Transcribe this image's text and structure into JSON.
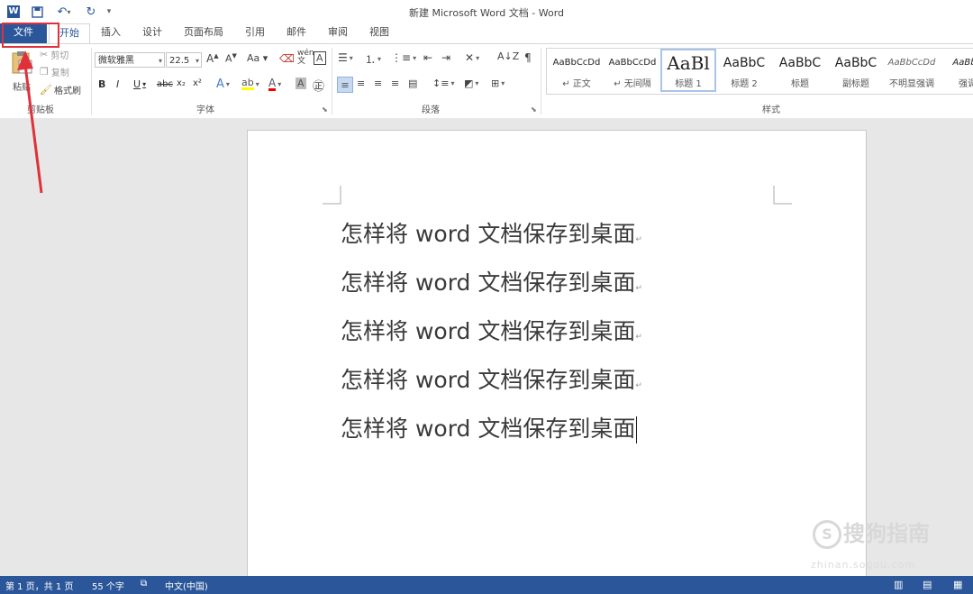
{
  "window": {
    "title": "新建 Microsoft Word 文档 - Word"
  },
  "quick_access": [
    "word-app-icon",
    "save-icon",
    "undo-icon",
    "redo-icon",
    "customize-qat-icon"
  ],
  "tabs": [
    {
      "label": "文件"
    },
    {
      "label": "开始"
    },
    {
      "label": "插入"
    },
    {
      "label": "设计"
    },
    {
      "label": "页面布局"
    },
    {
      "label": "引用"
    },
    {
      "label": "邮件"
    },
    {
      "label": "审阅"
    },
    {
      "label": "视图"
    }
  ],
  "clipboard": {
    "paste": "粘贴",
    "cut": "剪切",
    "copy": "复制",
    "format_painter": "格式刷",
    "group": "剪贴板"
  },
  "font": {
    "name": "微软雅黑",
    "size": "22.5",
    "group": "字体",
    "buttons": [
      "B",
      "I",
      "U",
      "abc",
      "x₂",
      "x²",
      "A",
      "A",
      "Aa",
      "A",
      "A"
    ]
  },
  "paragraph": {
    "group": "段落"
  },
  "styles": {
    "group": "样式",
    "items": [
      {
        "sample": "AaBbCcDd",
        "name": "↵ 正文"
      },
      {
        "sample": "AaBbCcDd",
        "name": "↵ 无间隔"
      },
      {
        "sample": "AaBl",
        "name": "标题 1"
      },
      {
        "sample": "AaBbC",
        "name": "标题 2"
      },
      {
        "sample": "AaBbC",
        "name": "标题"
      },
      {
        "sample": "AaBbC",
        "name": "副标题"
      },
      {
        "sample": "AaBbCcDd",
        "name": "不明显强调"
      },
      {
        "sample": "AaBbC",
        "name": "强调"
      }
    ]
  },
  "document": {
    "lines": [
      "怎样将 word 文档保存到桌面",
      "怎样将 word 文档保存到桌面",
      "怎样将 word 文档保存到桌面",
      "怎样将 word 文档保存到桌面",
      "怎样将 word 文档保存到桌面"
    ],
    "paragraph_mark": "↵"
  },
  "status": {
    "page": "第 1 页，共 1 页",
    "words": "55 个字",
    "language": "中文(中国)"
  },
  "watermark": {
    "brand": "搜狗指南",
    "url": "zhinan.sogou.com"
  },
  "colors": {
    "accent": "#2b579a",
    "annotation": "#e0313b"
  }
}
